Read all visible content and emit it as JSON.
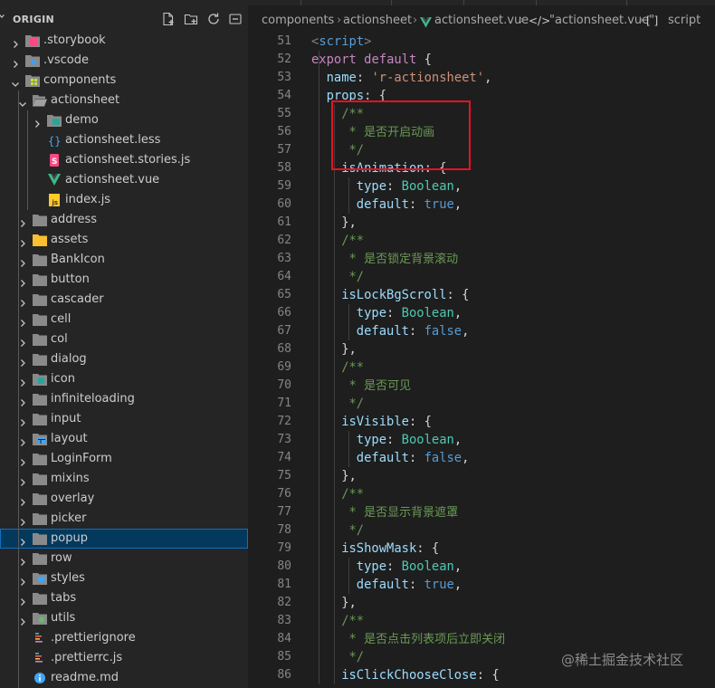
{
  "explorer": {
    "title": "ORIGIN",
    "actions": [
      "new-file-icon",
      "new-folder-icon",
      "refresh-icon",
      "collapse-all-icon"
    ],
    "items": [
      {
        "label": ".storybook",
        "kind": "folder",
        "icon": "storybook-folder-icon",
        "depth": 0,
        "expanded": false
      },
      {
        "label": ".vscode",
        "kind": "folder",
        "icon": "vscode-folder-icon",
        "depth": 0,
        "expanded": false
      },
      {
        "label": "components",
        "kind": "folder",
        "icon": "components-folder-icon",
        "depth": 0,
        "expanded": true
      },
      {
        "label": "actionsheet",
        "kind": "folder",
        "icon": "folder-open-icon",
        "depth": 1,
        "expanded": true
      },
      {
        "label": "demo",
        "kind": "folder",
        "icon": "demo-folder-icon",
        "depth": 2,
        "expanded": false
      },
      {
        "label": "actionsheet.less",
        "kind": "file",
        "icon": "less-file-icon",
        "depth": 2
      },
      {
        "label": "actionsheet.stories.js",
        "kind": "file",
        "icon": "storybook-file-icon",
        "depth": 2
      },
      {
        "label": "actionsheet.vue",
        "kind": "file",
        "icon": "vue-file-icon",
        "depth": 2
      },
      {
        "label": "index.js",
        "kind": "file",
        "icon": "js-file-icon",
        "depth": 2
      },
      {
        "label": "address",
        "kind": "folder",
        "icon": "folder-icon",
        "depth": 1,
        "expanded": false
      },
      {
        "label": "assets",
        "kind": "folder",
        "icon": "assets-folder-icon",
        "depth": 1,
        "expanded": false
      },
      {
        "label": "BankIcon",
        "kind": "folder",
        "icon": "folder-icon",
        "depth": 1,
        "expanded": false
      },
      {
        "label": "button",
        "kind": "folder",
        "icon": "folder-icon",
        "depth": 1,
        "expanded": false
      },
      {
        "label": "cascader",
        "kind": "folder",
        "icon": "folder-icon",
        "depth": 1,
        "expanded": false
      },
      {
        "label": "cell",
        "kind": "folder",
        "icon": "folder-icon",
        "depth": 1,
        "expanded": false
      },
      {
        "label": "col",
        "kind": "folder",
        "icon": "folder-icon",
        "depth": 1,
        "expanded": false
      },
      {
        "label": "dialog",
        "kind": "folder",
        "icon": "folder-icon",
        "depth": 1,
        "expanded": false
      },
      {
        "label": "icon",
        "kind": "folder",
        "icon": "icon-folder-icon",
        "depth": 1,
        "expanded": false
      },
      {
        "label": "infiniteloading",
        "kind": "folder",
        "icon": "folder-icon",
        "depth": 1,
        "expanded": false
      },
      {
        "label": "input",
        "kind": "folder",
        "icon": "folder-icon",
        "depth": 1,
        "expanded": false
      },
      {
        "label": "layout",
        "kind": "folder",
        "icon": "layout-folder-icon",
        "depth": 1,
        "expanded": false
      },
      {
        "label": "LoginForm",
        "kind": "folder",
        "icon": "folder-icon",
        "depth": 1,
        "expanded": false
      },
      {
        "label": "mixins",
        "kind": "folder",
        "icon": "folder-icon",
        "depth": 1,
        "expanded": false
      },
      {
        "label": "overlay",
        "kind": "folder",
        "icon": "folder-icon",
        "depth": 1,
        "expanded": false
      },
      {
        "label": "picker",
        "kind": "folder",
        "icon": "folder-icon",
        "depth": 1,
        "expanded": false
      },
      {
        "label": "popup",
        "kind": "folder",
        "icon": "folder-icon",
        "depth": 1,
        "expanded": false,
        "selected": true
      },
      {
        "label": "row",
        "kind": "folder",
        "icon": "folder-icon",
        "depth": 1,
        "expanded": false
      },
      {
        "label": "styles",
        "kind": "folder",
        "icon": "styles-folder-icon",
        "depth": 1,
        "expanded": false
      },
      {
        "label": "tabs",
        "kind": "folder",
        "icon": "folder-icon",
        "depth": 1,
        "expanded": false
      },
      {
        "label": "utils",
        "kind": "folder",
        "icon": "utils-folder-icon",
        "depth": 1,
        "expanded": false
      },
      {
        "label": ".prettierignore",
        "kind": "file",
        "icon": "prettier-file-icon",
        "depth": 1
      },
      {
        "label": ".prettierrc.js",
        "kind": "file",
        "icon": "prettier-file-icon",
        "depth": 1
      },
      {
        "label": "readme.md",
        "kind": "file",
        "icon": "info-file-icon",
        "depth": 1
      }
    ]
  },
  "breadcrumb": {
    "segments": [
      "components",
      "actionsheet",
      "actionsheet.vue",
      "\"actionsheet.vue\"",
      "script"
    ],
    "icons": [
      "vue-file-icon",
      "code-bracket-icon",
      "bracket-icon"
    ]
  },
  "editor": {
    "lines": [
      {
        "n": "51",
        "indent": 0,
        "tokens": [
          [
            "tag",
            "<"
          ],
          [
            "tagname",
            "script"
          ],
          [
            "tag",
            ">"
          ]
        ]
      },
      {
        "n": "52",
        "indent": 0,
        "tokens": [
          [
            "kw",
            "export"
          ],
          [
            "punc",
            " "
          ],
          [
            "kw",
            "default"
          ],
          [
            "punc",
            " {"
          ]
        ]
      },
      {
        "n": "53",
        "indent": 1,
        "tokens": [
          [
            "prop",
            "name"
          ],
          [
            "punc",
            ": "
          ],
          [
            "str",
            "'r-actionsheet'"
          ],
          [
            "punc",
            ","
          ]
        ]
      },
      {
        "n": "54",
        "indent": 1,
        "tokens": [
          [
            "prop",
            "props"
          ],
          [
            "punc",
            ": {"
          ]
        ]
      },
      {
        "n": "55",
        "indent": 2,
        "tokens": [
          [
            "cm",
            "/**"
          ]
        ]
      },
      {
        "n": "56",
        "indent": 2,
        "tokens": [
          [
            "cm",
            " * "
          ],
          [
            "cmcjk",
            "是否开启动画"
          ]
        ]
      },
      {
        "n": "57",
        "indent": 2,
        "tokens": [
          [
            "cm",
            " */"
          ]
        ]
      },
      {
        "n": "58",
        "indent": 2,
        "tokens": [
          [
            "prop",
            "isAnimation"
          ],
          [
            "punc",
            ": {"
          ]
        ]
      },
      {
        "n": "59",
        "indent": 3,
        "tokens": [
          [
            "prop",
            "type"
          ],
          [
            "punc",
            ": "
          ],
          [
            "type",
            "Boolean"
          ],
          [
            "punc",
            ","
          ]
        ]
      },
      {
        "n": "60",
        "indent": 3,
        "tokens": [
          [
            "prop",
            "default"
          ],
          [
            "punc",
            ": "
          ],
          [
            "bool",
            "true"
          ],
          [
            "punc",
            ","
          ]
        ]
      },
      {
        "n": "61",
        "indent": 2,
        "tokens": [
          [
            "punc",
            "},"
          ]
        ]
      },
      {
        "n": "62",
        "indent": 2,
        "tokens": [
          [
            "cm",
            "/**"
          ]
        ]
      },
      {
        "n": "63",
        "indent": 2,
        "tokens": [
          [
            "cm",
            " * "
          ],
          [
            "cmcjk",
            "是否锁定背景滚动"
          ]
        ]
      },
      {
        "n": "64",
        "indent": 2,
        "tokens": [
          [
            "cm",
            " */"
          ]
        ]
      },
      {
        "n": "65",
        "indent": 2,
        "tokens": [
          [
            "prop",
            "isLockBgScroll"
          ],
          [
            "punc",
            ": {"
          ]
        ]
      },
      {
        "n": "66",
        "indent": 3,
        "tokens": [
          [
            "prop",
            "type"
          ],
          [
            "punc",
            ": "
          ],
          [
            "type",
            "Boolean"
          ],
          [
            "punc",
            ","
          ]
        ]
      },
      {
        "n": "67",
        "indent": 3,
        "tokens": [
          [
            "prop",
            "default"
          ],
          [
            "punc",
            ": "
          ],
          [
            "bool",
            "false"
          ],
          [
            "punc",
            ","
          ]
        ]
      },
      {
        "n": "68",
        "indent": 2,
        "tokens": [
          [
            "punc",
            "},"
          ]
        ]
      },
      {
        "n": "69",
        "indent": 2,
        "tokens": [
          [
            "cm",
            "/**"
          ]
        ]
      },
      {
        "n": "70",
        "indent": 2,
        "tokens": [
          [
            "cm",
            " * "
          ],
          [
            "cmcjk",
            "是否可见"
          ]
        ]
      },
      {
        "n": "71",
        "indent": 2,
        "tokens": [
          [
            "cm",
            " */"
          ]
        ]
      },
      {
        "n": "72",
        "indent": 2,
        "tokens": [
          [
            "prop",
            "isVisible"
          ],
          [
            "punc",
            ": {"
          ]
        ]
      },
      {
        "n": "73",
        "indent": 3,
        "tokens": [
          [
            "prop",
            "type"
          ],
          [
            "punc",
            ": "
          ],
          [
            "type",
            "Boolean"
          ],
          [
            "punc",
            ","
          ]
        ]
      },
      {
        "n": "74",
        "indent": 3,
        "tokens": [
          [
            "prop",
            "default"
          ],
          [
            "punc",
            ": "
          ],
          [
            "bool",
            "false"
          ],
          [
            "punc",
            ","
          ]
        ]
      },
      {
        "n": "75",
        "indent": 2,
        "tokens": [
          [
            "punc",
            "},"
          ]
        ]
      },
      {
        "n": "76",
        "indent": 2,
        "tokens": [
          [
            "cm",
            "/**"
          ]
        ]
      },
      {
        "n": "77",
        "indent": 2,
        "tokens": [
          [
            "cm",
            " * "
          ],
          [
            "cmcjk",
            "是否显示背景遮罩"
          ]
        ]
      },
      {
        "n": "78",
        "indent": 2,
        "tokens": [
          [
            "cm",
            " */"
          ]
        ]
      },
      {
        "n": "79",
        "indent": 2,
        "tokens": [
          [
            "prop",
            "isShowMask"
          ],
          [
            "punc",
            ": {"
          ]
        ]
      },
      {
        "n": "80",
        "indent": 3,
        "tokens": [
          [
            "prop",
            "type"
          ],
          [
            "punc",
            ": "
          ],
          [
            "type",
            "Boolean"
          ],
          [
            "punc",
            ","
          ]
        ]
      },
      {
        "n": "81",
        "indent": 3,
        "tokens": [
          [
            "prop",
            "default"
          ],
          [
            "punc",
            ": "
          ],
          [
            "bool",
            "true"
          ],
          [
            "punc",
            ","
          ]
        ]
      },
      {
        "n": "82",
        "indent": 2,
        "tokens": [
          [
            "punc",
            "},"
          ]
        ]
      },
      {
        "n": "83",
        "indent": 2,
        "tokens": [
          [
            "cm",
            "/**"
          ]
        ]
      },
      {
        "n": "84",
        "indent": 2,
        "tokens": [
          [
            "cm",
            " * "
          ],
          [
            "cmcjk",
            "是否点击列表项后立即关闭"
          ]
        ]
      },
      {
        "n": "85",
        "indent": 2,
        "tokens": [
          [
            "cm",
            " */"
          ]
        ]
      },
      {
        "n": "86",
        "indent": 2,
        "tokens": [
          [
            "prop",
            "isClickChooseClose"
          ],
          [
            "punc",
            ": {"
          ]
        ]
      }
    ]
  },
  "watermark": "@稀土掘金技术社区",
  "colors": {
    "selection": "#04395e",
    "highlight_box": "#e81123",
    "folder": "#8a8a8a"
  }
}
